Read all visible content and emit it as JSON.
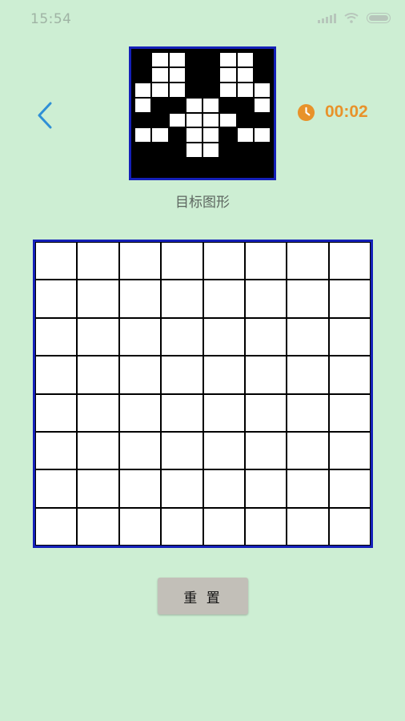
{
  "status_bar": {
    "time": "15:54",
    "icons": [
      "signal-icon",
      "wifi-icon",
      "battery-icon"
    ]
  },
  "header": {
    "back_icon": "chevron-left-icon",
    "timer_icon": "clock-icon",
    "timer": "00:02"
  },
  "target": {
    "label": "目标图形",
    "rows": 8,
    "cols": 8,
    "pattern": [
      [
        0,
        1,
        1,
        0,
        0,
        1,
        1,
        0
      ],
      [
        0,
        1,
        1,
        0,
        0,
        1,
        1,
        0
      ],
      [
        1,
        1,
        1,
        0,
        0,
        1,
        1,
        1
      ],
      [
        1,
        0,
        0,
        1,
        1,
        0,
        0,
        1
      ],
      [
        0,
        0,
        1,
        1,
        1,
        1,
        0,
        0
      ],
      [
        1,
        1,
        0,
        1,
        1,
        0,
        1,
        1
      ],
      [
        0,
        0,
        0,
        1,
        1,
        0,
        0,
        0
      ],
      [
        0,
        0,
        0,
        0,
        0,
        0,
        0,
        0
      ]
    ]
  },
  "board": {
    "rows": 8,
    "cols": 8
  },
  "reset_label": "重 置",
  "colors": {
    "background": "#cdeed3",
    "board_border": "#1420b8",
    "timer": "#e8922a",
    "back_arrow": "#2f8fd6",
    "reset_button": "#c2bfb8"
  }
}
